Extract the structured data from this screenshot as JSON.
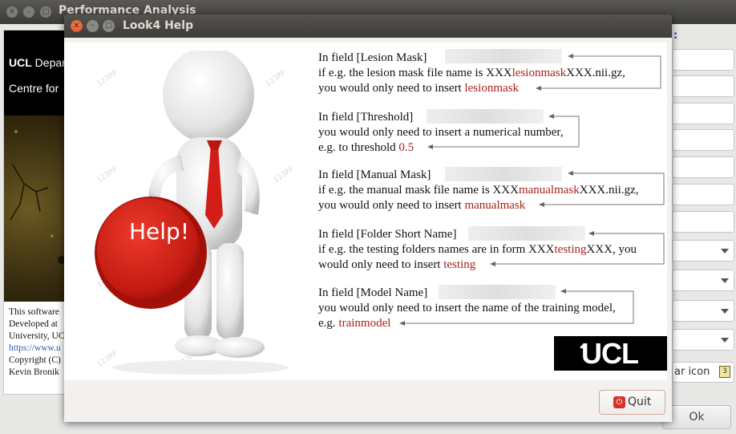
{
  "background_window": {
    "title": "Performance Analysis",
    "left_panel": {
      "ucl_label": "UCL",
      "ucl_rest": " Department",
      "centre": "Centre for",
      "info_lines": [
        "This software",
        "Developed at",
        "University, UC",
        "https://www.u",
        "Copyright (C)",
        "Kevin Bronik"
      ]
    },
    "colon": ":",
    "icon_field_value": "ar icon",
    "ok_label": "Ok"
  },
  "dialog": {
    "title": "Look4 Help",
    "help_image_text": "Help!",
    "watermark": "123RF",
    "blocks": [
      {
        "line1": "In  field  [Lesion Mask]",
        "line2_pre": "if e.g. the lesion mask file name is XXX",
        "line2_red": "lesionmask",
        "line2_post": "XXX.nii.gz,",
        "line3_pre": "you would only need to insert ",
        "line3_red": "lesionmask"
      },
      {
        "line1": "In  field [Threshold]",
        "line2": "you would only need to insert a numerical number,",
        "line3_pre": "e.g. to threshold  ",
        "line3_red": "0.5"
      },
      {
        "line1": "In  field [Manual Mask]",
        "line2_pre": "if e.g. the manual mask file name is XXX",
        "line2_red": "manualmask",
        "line2_post": "XXX.nii.gz,",
        "line3_pre": "you would only need to insert ",
        "line3_red": "manualmask"
      },
      {
        "line1": "In field [Folder Short Name]",
        "line2_pre": "if e.g. the testing folders names are in form  XXX",
        "line2_red": "testing",
        "line2_post": "XXX, you",
        "line3_pre": "would only need to insert ",
        "line3_red": "testing"
      },
      {
        "line1": "In field [Model Name]",
        "line2": "you would only need to insert the name of the training model,",
        "line3_pre": "e.g. ",
        "line3_red": "trainmodel"
      }
    ],
    "logo_text": "UCL",
    "quit_label": "Quit"
  },
  "colors": {
    "accent_red": "#a8201a",
    "title_bar": "#3d3c38",
    "close_button": "#de4d1b"
  }
}
